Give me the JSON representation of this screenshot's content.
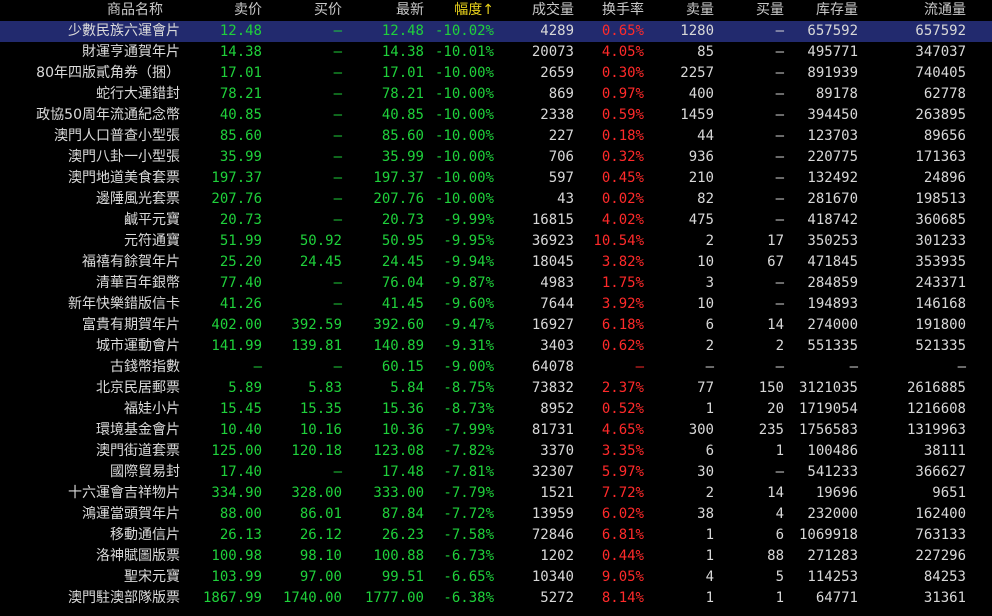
{
  "columns": {
    "name": "商品名称",
    "sell": "卖价",
    "buy": "买价",
    "last": "最新",
    "change": "幅度↑",
    "volume": "成交量",
    "turnover": "换手率",
    "sell_qty": "卖量",
    "buy_qty": "买量",
    "inventory": "库存量",
    "float": "流通量"
  },
  "rows": [
    {
      "name": "少數民族六運會片",
      "sell": "12.48",
      "buy": "—",
      "last": "12.48",
      "change": "-10.02%",
      "volume": "4289",
      "turnover": "0.65%",
      "sell_qty": "1280",
      "buy_qty": "—",
      "inventory": "657592",
      "float": "657592"
    },
    {
      "name": "財運亨通賀年片",
      "sell": "14.38",
      "buy": "—",
      "last": "14.38",
      "change": "-10.01%",
      "volume": "20073",
      "turnover": "4.05%",
      "sell_qty": "85",
      "buy_qty": "—",
      "inventory": "495771",
      "float": "347037"
    },
    {
      "name": "80年四版貳角券（捆）",
      "sell": "17.01",
      "buy": "—",
      "last": "17.01",
      "change": "-10.00%",
      "volume": "2659",
      "turnover": "0.30%",
      "sell_qty": "2257",
      "buy_qty": "—",
      "inventory": "891939",
      "float": "740405"
    },
    {
      "name": "蛇行大運錯封",
      "sell": "78.21",
      "buy": "—",
      "last": "78.21",
      "change": "-10.00%",
      "volume": "869",
      "turnover": "0.97%",
      "sell_qty": "400",
      "buy_qty": "—",
      "inventory": "89178",
      "float": "62778"
    },
    {
      "name": "政協50周年流通紀念幣",
      "sell": "40.85",
      "buy": "—",
      "last": "40.85",
      "change": "-10.00%",
      "volume": "2338",
      "turnover": "0.59%",
      "sell_qty": "1459",
      "buy_qty": "—",
      "inventory": "394450",
      "float": "263895"
    },
    {
      "name": "澳門人口普查小型張",
      "sell": "85.60",
      "buy": "—",
      "last": "85.60",
      "change": "-10.00%",
      "volume": "227",
      "turnover": "0.18%",
      "sell_qty": "44",
      "buy_qty": "—",
      "inventory": "123703",
      "float": "89656"
    },
    {
      "name": "澳門八卦一小型張",
      "sell": "35.99",
      "buy": "—",
      "last": "35.99",
      "change": "-10.00%",
      "volume": "706",
      "turnover": "0.32%",
      "sell_qty": "936",
      "buy_qty": "—",
      "inventory": "220775",
      "float": "171363"
    },
    {
      "name": "澳門地道美食套票",
      "sell": "197.37",
      "buy": "—",
      "last": "197.37",
      "change": "-10.00%",
      "volume": "597",
      "turnover": "0.45%",
      "sell_qty": "210",
      "buy_qty": "—",
      "inventory": "132492",
      "float": "24896"
    },
    {
      "name": "邊陲風光套票",
      "sell": "207.76",
      "buy": "—",
      "last": "207.76",
      "change": "-10.00%",
      "volume": "43",
      "turnover": "0.02%",
      "sell_qty": "82",
      "buy_qty": "—",
      "inventory": "281670",
      "float": "198513"
    },
    {
      "name": "鹹平元寶",
      "sell": "20.73",
      "buy": "—",
      "last": "20.73",
      "change": "-9.99%",
      "volume": "16815",
      "turnover": "4.02%",
      "sell_qty": "475",
      "buy_qty": "—",
      "inventory": "418742",
      "float": "360685"
    },
    {
      "name": "元符通寶",
      "sell": "51.99",
      "buy": "50.92",
      "last": "50.95",
      "change": "-9.95%",
      "volume": "36923",
      "turnover": "10.54%",
      "sell_qty": "2",
      "buy_qty": "17",
      "inventory": "350253",
      "float": "301233"
    },
    {
      "name": "福禧有餘賀年片",
      "sell": "25.20",
      "buy": "24.45",
      "last": "24.45",
      "change": "-9.94%",
      "volume": "18045",
      "turnover": "3.82%",
      "sell_qty": "10",
      "buy_qty": "67",
      "inventory": "471845",
      "float": "353935"
    },
    {
      "name": "清華百年銀幣",
      "sell": "77.40",
      "buy": "—",
      "last": "76.04",
      "change": "-9.87%",
      "volume": "4983",
      "turnover": "1.75%",
      "sell_qty": "3",
      "buy_qty": "—",
      "inventory": "284859",
      "float": "243371"
    },
    {
      "name": "新年快樂錯版信卡",
      "sell": "41.26",
      "buy": "—",
      "last": "41.45",
      "change": "-9.60%",
      "volume": "7644",
      "turnover": "3.92%",
      "sell_qty": "10",
      "buy_qty": "—",
      "inventory": "194893",
      "float": "146168"
    },
    {
      "name": "富貴有期賀年片",
      "sell": "402.00",
      "buy": "392.59",
      "last": "392.60",
      "change": "-9.47%",
      "volume": "16927",
      "turnover": "6.18%",
      "sell_qty": "6",
      "buy_qty": "14",
      "inventory": "274000",
      "float": "191800"
    },
    {
      "name": "城市運動會片",
      "sell": "141.99",
      "buy": "139.81",
      "last": "140.89",
      "change": "-9.31%",
      "volume": "3403",
      "turnover": "0.62%",
      "sell_qty": "2",
      "buy_qty": "2",
      "inventory": "551335",
      "float": "521335"
    },
    {
      "name": "古錢幣指數",
      "sell": "—",
      "buy": "—",
      "last": "60.15",
      "change": "-9.00%",
      "volume": "64078",
      "turnover": "—",
      "sell_qty": "—",
      "buy_qty": "—",
      "inventory": "—",
      "float": "—"
    },
    {
      "name": "北京民居郵票",
      "sell": "5.89",
      "buy": "5.83",
      "last": "5.84",
      "change": "-8.75%",
      "volume": "73832",
      "turnover": "2.37%",
      "sell_qty": "77",
      "buy_qty": "150",
      "inventory": "3121035",
      "float": "2616885"
    },
    {
      "name": "福娃小片",
      "sell": "15.45",
      "buy": "15.35",
      "last": "15.36",
      "change": "-8.73%",
      "volume": "8952",
      "turnover": "0.52%",
      "sell_qty": "1",
      "buy_qty": "20",
      "inventory": "1719054",
      "float": "1216608"
    },
    {
      "name": "環境基金會片",
      "sell": "10.40",
      "buy": "10.16",
      "last": "10.36",
      "change": "-7.99%",
      "volume": "81731",
      "turnover": "4.65%",
      "sell_qty": "300",
      "buy_qty": "235",
      "inventory": "1756583",
      "float": "1319963"
    },
    {
      "name": "澳門街道套票",
      "sell": "125.00",
      "buy": "120.18",
      "last": "123.08",
      "change": "-7.82%",
      "volume": "3370",
      "turnover": "3.35%",
      "sell_qty": "6",
      "buy_qty": "1",
      "inventory": "100486",
      "float": "38111"
    },
    {
      "name": "國際貿易封",
      "sell": "17.40",
      "buy": "—",
      "last": "17.48",
      "change": "-7.81%",
      "volume": "32307",
      "turnover": "5.97%",
      "sell_qty": "30",
      "buy_qty": "—",
      "inventory": "541233",
      "float": "366627"
    },
    {
      "name": "十六運會吉祥物片",
      "sell": "334.90",
      "buy": "328.00",
      "last": "333.00",
      "change": "-7.79%",
      "volume": "1521",
      "turnover": "7.72%",
      "sell_qty": "2",
      "buy_qty": "14",
      "inventory": "19696",
      "float": "9651"
    },
    {
      "name": "鴻運當頭賀年片",
      "sell": "88.00",
      "buy": "86.01",
      "last": "87.84",
      "change": "-7.72%",
      "volume": "13959",
      "turnover": "6.02%",
      "sell_qty": "38",
      "buy_qty": "4",
      "inventory": "232000",
      "float": "162400"
    },
    {
      "name": "移動通信片",
      "sell": "26.13",
      "buy": "26.12",
      "last": "26.23",
      "change": "-7.58%",
      "volume": "72846",
      "turnover": "6.81%",
      "sell_qty": "1",
      "buy_qty": "6",
      "inventory": "1069918",
      "float": "763133"
    },
    {
      "name": "洛神賦圖版票",
      "sell": "100.98",
      "buy": "98.10",
      "last": "100.88",
      "change": "-6.73%",
      "volume": "1202",
      "turnover": "0.44%",
      "sell_qty": "1",
      "buy_qty": "88",
      "inventory": "271283",
      "float": "227296"
    },
    {
      "name": "聖宋元寶",
      "sell": "103.99",
      "buy": "97.00",
      "last": "99.51",
      "change": "-6.65%",
      "volume": "10340",
      "turnover": "9.05%",
      "sell_qty": "4",
      "buy_qty": "5",
      "inventory": "114253",
      "float": "84253"
    },
    {
      "name": "澳門駐澳部隊版票",
      "sell": "1867.99",
      "buy": "1740.00",
      "last": "1777.00",
      "change": "-6.38%",
      "volume": "5272",
      "turnover": "8.14%",
      "sell_qty": "1",
      "buy_qty": "1",
      "inventory": "64771",
      "float": "31361"
    }
  ],
  "selected_row": 0,
  "colors": {
    "background": "#000000",
    "selected_row": "#222a6e",
    "price_green": "#1fd13b",
    "turnover_red": "#ff2a2a",
    "sort_yellow": "#e8d21b",
    "text_white": "#d8d8d8"
  }
}
